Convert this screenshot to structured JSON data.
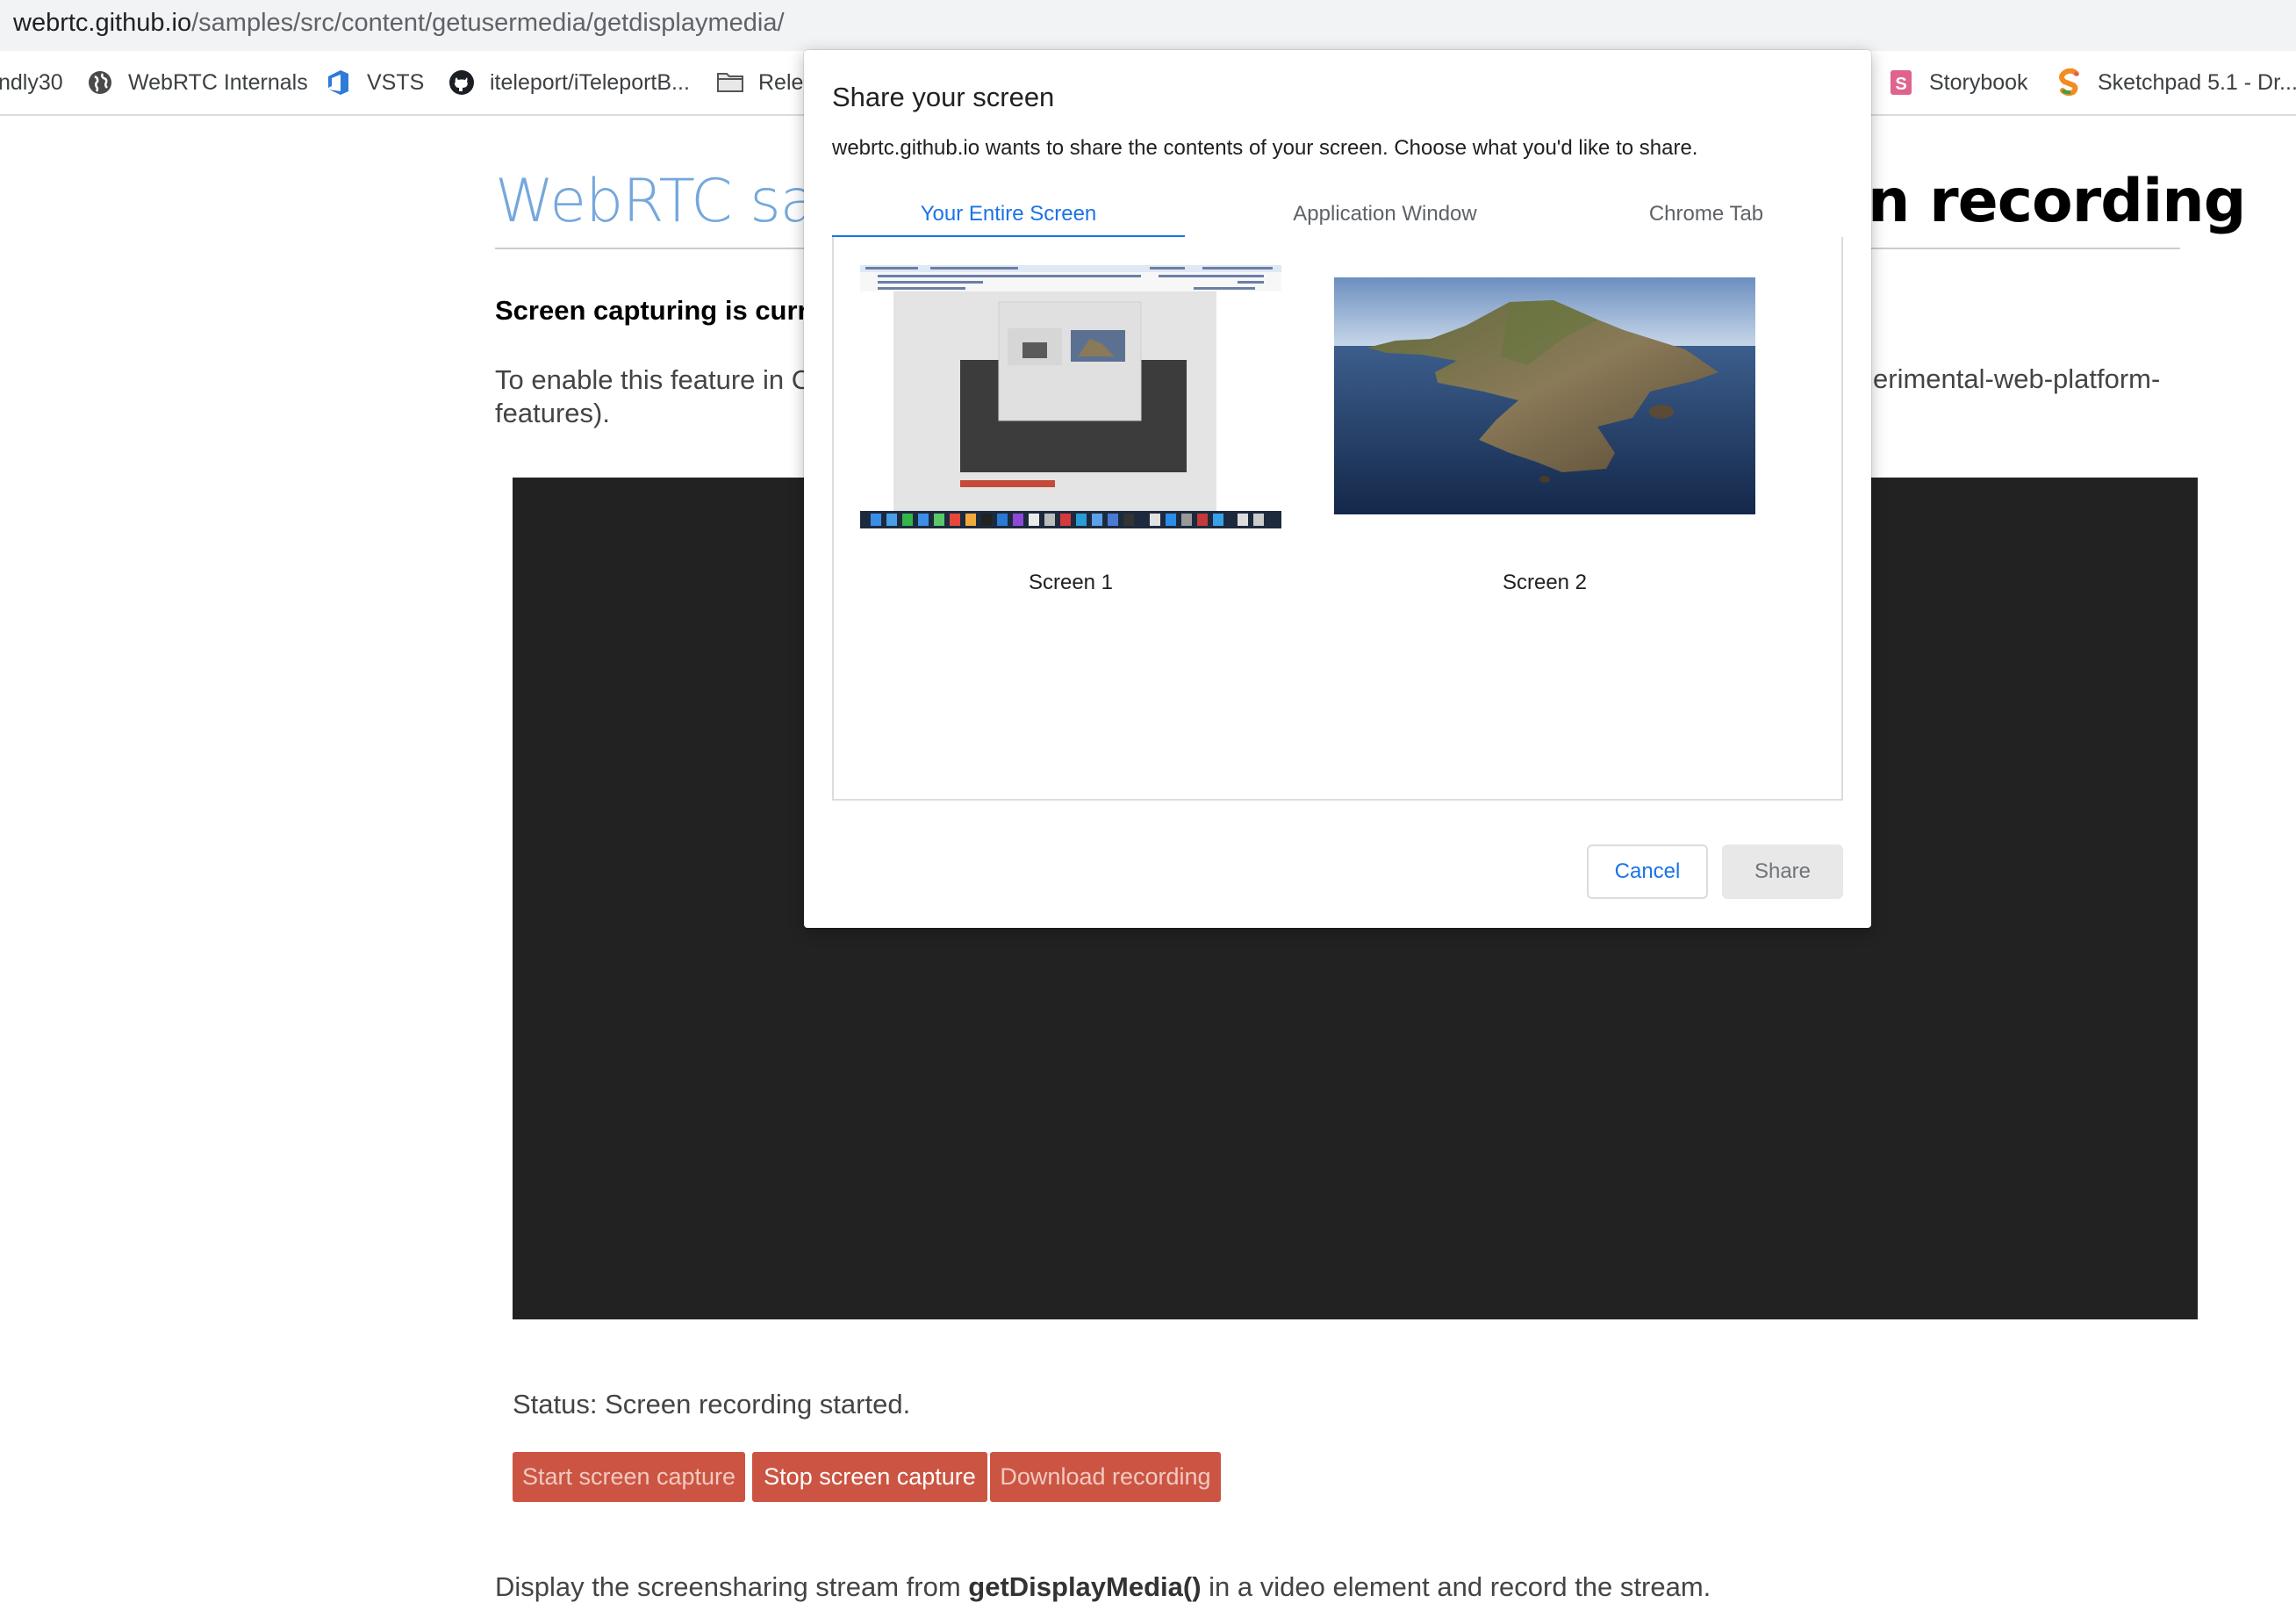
{
  "browser": {
    "url_host": "webrtc.github.io",
    "url_path": "/samples/src/content/getusermedia/getdisplaymedia/",
    "bookmarks": [
      {
        "label": "ndly30",
        "icon": "none"
      },
      {
        "label": "WebRTC Internals",
        "icon": "globe-icon"
      },
      {
        "label": "VSTS",
        "icon": "azure-devops-icon"
      },
      {
        "label": "iteleport/iTeleportB...",
        "icon": "github-icon"
      },
      {
        "label": "Relea",
        "icon": "folder-icon"
      },
      {
        "label": "Storybook",
        "icon": "storybook-icon"
      },
      {
        "label": "Sketchpad 5.1 - Dr...",
        "icon": "sketchpad-icon"
      }
    ]
  },
  "page": {
    "title_left": "WebRTC san",
    "title_right": "n recording",
    "warning": "Screen capturing is curre",
    "enable_line1": "To enable this feature in C",
    "enable_line1_right": "erimental-web-platform-",
    "enable_line2": "features).",
    "status": "Status: Screen recording started.",
    "buttons": {
      "start": "Start screen capture",
      "stop": "Stop screen capture",
      "download": "Download recording"
    },
    "description_before": "Display the screensharing stream from ",
    "description_code": "getDisplayMedia()",
    "description_after": " in a video element and record the stream."
  },
  "dialog": {
    "title": "Share your screen",
    "description": "webrtc.github.io wants to share the contents of your screen. Choose what you'd like to share.",
    "tabs": [
      {
        "label": "Your Entire Screen",
        "active": true
      },
      {
        "label": "Application Window",
        "active": false
      },
      {
        "label": "Chrome Tab",
        "active": false
      }
    ],
    "sources": [
      {
        "label": "Screen 1",
        "thumbnail": "desktop-screenshot"
      },
      {
        "label": "Screen 2",
        "thumbnail": "island-wallpaper"
      }
    ],
    "cancel_label": "Cancel",
    "share_label": "Share"
  },
  "colors": {
    "accent_blue": "#1a73e8",
    "title_blue": "#75a7dd",
    "button_red": "#cb5542",
    "video_bg": "#222222"
  }
}
